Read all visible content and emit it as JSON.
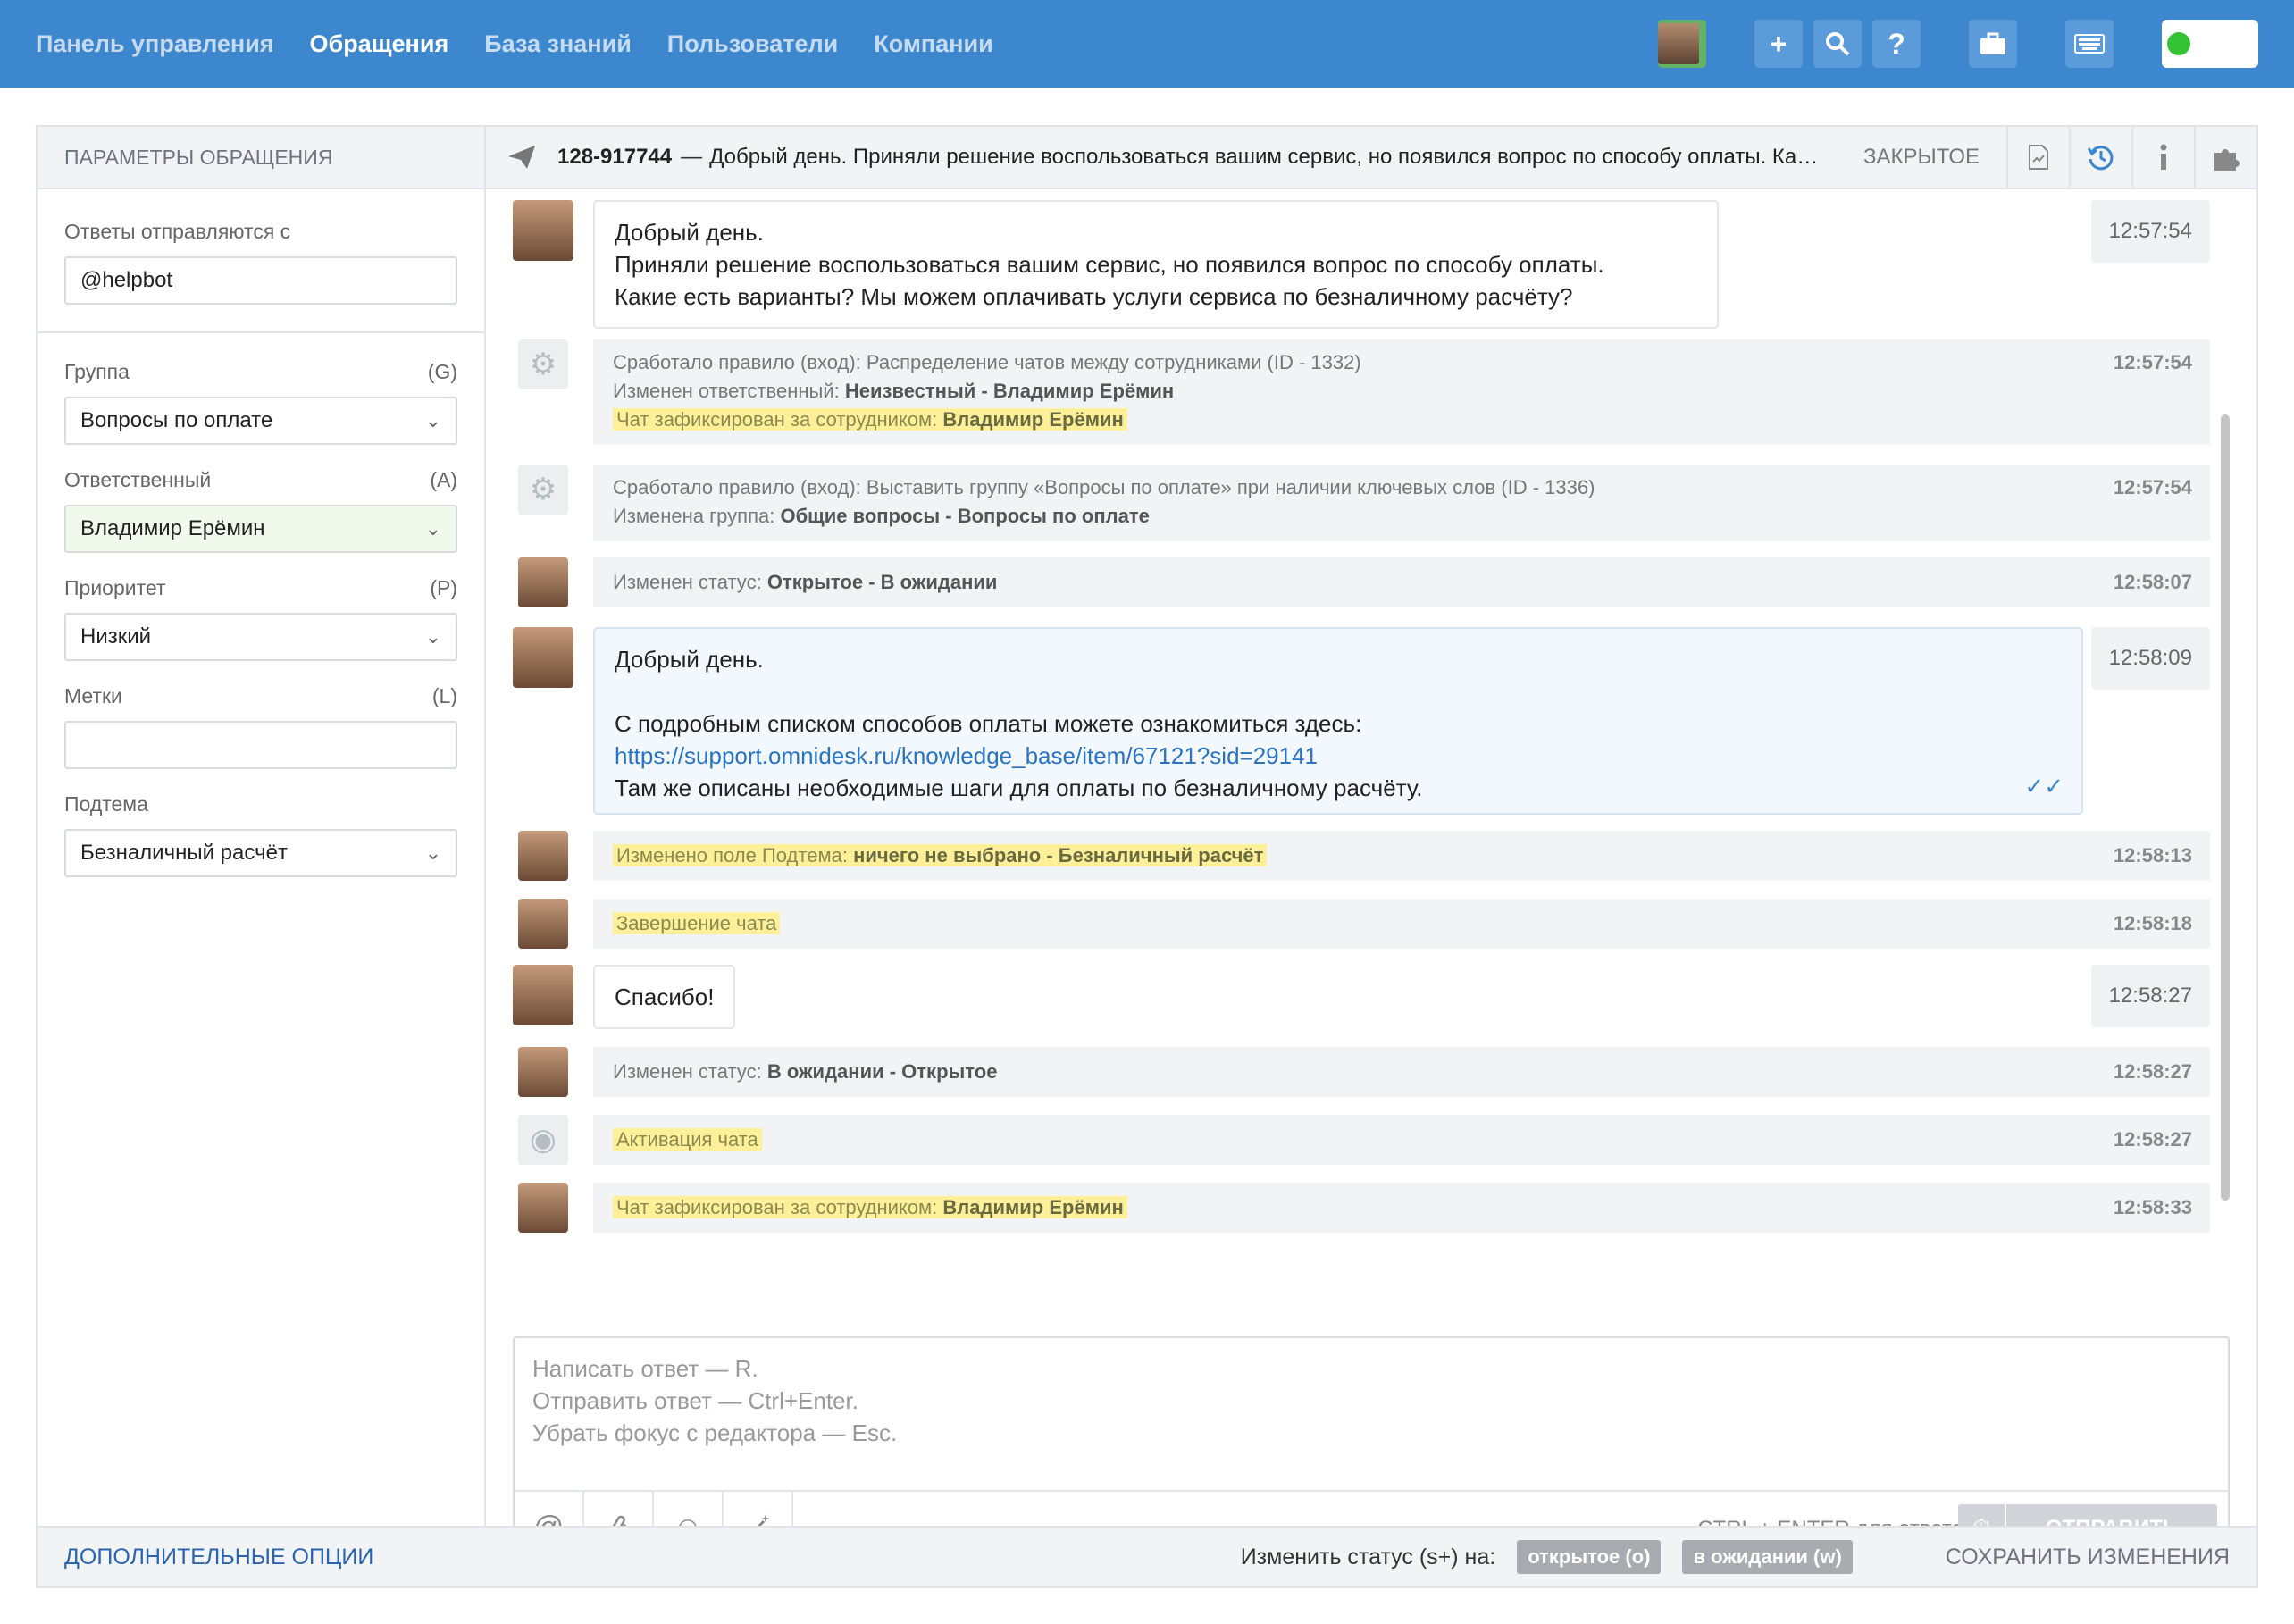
{
  "topnav": {
    "items": [
      "Панель управления",
      "Обращения",
      "База знаний",
      "Пользователи",
      "Компании"
    ],
    "active_index": 1
  },
  "toolbar_icons": [
    "at-icon",
    "plus-icon",
    "search-icon",
    "help-icon",
    "briefcase-icon",
    "keyboard-icon"
  ],
  "left_panel": {
    "header": "ПАРАМЕТРЫ ОБРАЩЕНИЯ",
    "reply_from_label": "Ответы отправляются с",
    "reply_from_value": "@helpbot",
    "group": {
      "label": "Группа",
      "key": "(G)",
      "value": "Вопросы по оплате"
    },
    "assignee": {
      "label": "Ответственный",
      "key": "(A)",
      "value": "Владимир Ерёмин"
    },
    "priority": {
      "label": "Приоритет",
      "key": "(P)",
      "value": "Низкий"
    },
    "tags": {
      "label": "Метки",
      "key": "(L)",
      "value": ""
    },
    "subtopic": {
      "label": "Подтема",
      "value": "Безналичный расчёт"
    }
  },
  "conversation": {
    "id": "128-917744",
    "dash": "—",
    "title": "Добрый день. Приняли решение воспользоваться вашим сервис, но появился вопрос по способу оплаты. Какие есть варианты?",
    "status": "ЗАКРЫТОЕ",
    "msg1": {
      "line1": "Добрый день.",
      "line2": "Приняли решение воспользоваться вашим сервис, но появился вопрос по способу оплаты.",
      "line3": "Какие есть варианты? Мы можем оплачивать услуги сервиса по безналичному расчёту?",
      "time": "12:57:54"
    },
    "ev1": {
      "line1": "Сработало правило (вход): Распределение чатов между сотрудниками (ID - 1332)",
      "line2_prefix": "Изменен ответственный:",
      "line2_value": "Неизвестный - Владимир Ерёмин",
      "line3_prefix": "Чат зафиксирован за сотрудником:",
      "line3_value": "Владимир Ерёмин",
      "time": "12:57:54"
    },
    "ev2": {
      "line1": "Сработало правило (вход): Выставить группу «Вопросы по оплате» при наличии ключевых слов (ID - 1336)",
      "line2_prefix": "Изменена группа:",
      "line2_value": "Общие вопросы - Вопросы по оплате",
      "time": "12:57:54"
    },
    "ev3": {
      "prefix": "Изменен статус:",
      "value": "Открытое - В ожидании",
      "time": "12:58:07"
    },
    "msg2": {
      "line1": "Добрый день.",
      "line2": "С подробным списком способов оплаты можете ознакомиться здесь:",
      "link": "https://support.omnidesk.ru/knowledge_base/item/67121?sid=29141",
      "line4": "Там же описаны необходимые шаги для оплаты по безналичному расчёту.",
      "time": "12:58:09"
    },
    "ev4": {
      "prefix": "Изменено поле Подтема:",
      "value": "ничего не выбрано - Безналичный расчёт",
      "time": "12:58:13"
    },
    "ev5": {
      "text": "Завершение чата",
      "time": "12:58:18"
    },
    "msg3": {
      "text": "Спасибо!",
      "time": "12:58:27"
    },
    "ev6": {
      "prefix": "Изменен статус:",
      "value": "В ожидании - Открытое",
      "time": "12:58:27"
    },
    "ev7": {
      "text": "Активация чата",
      "time": "12:58:27"
    },
    "ev8": {
      "prefix": "Чат зафиксирован за сотрудником:",
      "value": "Владимир Ерёмин",
      "time": "12:58:33"
    }
  },
  "composer": {
    "line1": "Написать ответ — R.",
    "line2": "Отправить ответ — Ctrl+Enter.",
    "line3": "Убрать фокус с редактора — Esc.",
    "hint": "CTRL + ENTER для ответа",
    "send": "ОТПРАВИТЬ"
  },
  "footer": {
    "more_options": "ДОПОЛНИТЕЛЬНЫЕ ОПЦИИ",
    "change_status": "Изменить статус (s+) на:",
    "status_open": "открытое (o)",
    "status_waiting": "в ожидании (w)",
    "save": "СОХРАНИТЬ ИЗМЕНЕНИЯ"
  },
  "colors": {
    "topbar": "#3c87cd",
    "highlight": "#fdf099",
    "link": "#2a73c3"
  }
}
